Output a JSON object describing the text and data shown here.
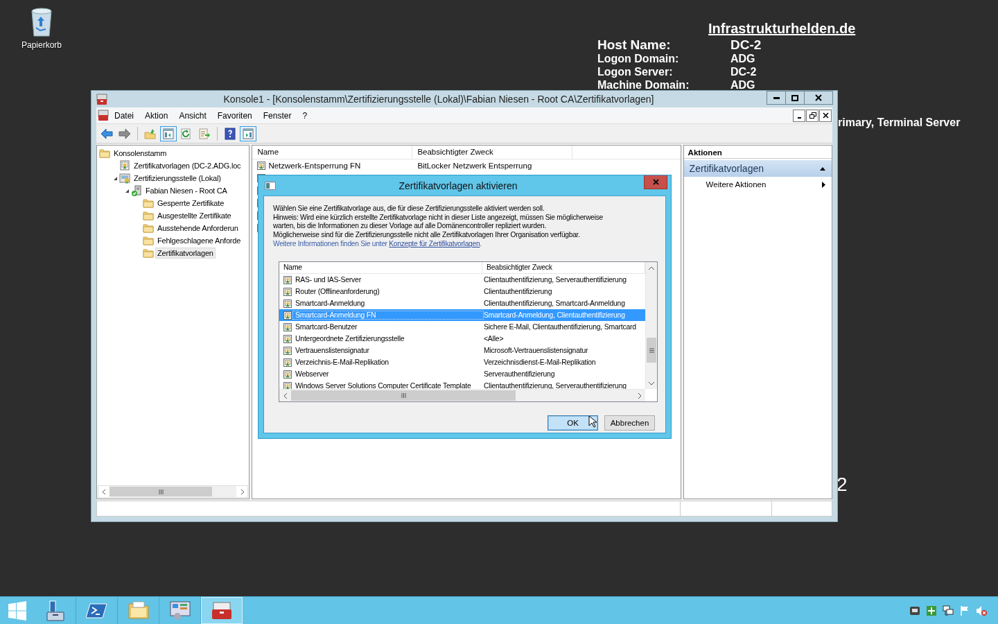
{
  "desktop": {
    "icons": [
      {
        "label": "Papierkorb"
      }
    ],
    "info": {
      "title": "Infrastrukturhelden.de",
      "rows": [
        {
          "label": "Host Name:",
          "value": "DC-2",
          "kind": "large"
        },
        {
          "label": "Logon Domain:",
          "value": "ADG",
          "kind": "normal"
        },
        {
          "label": "Logon Server:",
          "value": "DC-2",
          "kind": "normal"
        },
        {
          "label": "Machine Domain:",
          "value": "ADG",
          "kind": "normal"
        }
      ],
      "fragments": [
        "rimary, Terminal Server",
        "2"
      ]
    }
  },
  "window": {
    "title": "Konsole1 - [Konsolenstamm\\Zertifizierungsstelle (Lokal)\\Fabian Niesen - Root CA\\Zertifikatvorlagen]",
    "menu": [
      "Datei",
      "Aktion",
      "Ansicht",
      "Favoriten",
      "Fenster",
      "?"
    ],
    "toolbar": [
      [
        {
          "kind": "back",
          "on": false
        },
        {
          "kind": "forward",
          "on": false
        }
      ],
      [
        {
          "kind": "up",
          "on": false
        },
        {
          "kind": "console-tree",
          "on": true
        },
        {
          "kind": "refresh",
          "on": false
        },
        {
          "kind": "export",
          "on": false
        }
      ],
      [
        {
          "kind": "help",
          "on": false
        },
        {
          "kind": "action-pane",
          "on": true
        }
      ]
    ],
    "tree": [
      {
        "label": "Konsolenstamm",
        "kind": "folder",
        "selected": false,
        "children": [
          {
            "label": "Zertifikatvorlagen (DC-2.ADG.loc",
            "kind": "template",
            "expanded": false,
            "selected": false
          },
          {
            "label": "Zertifizierungsstelle (Lokal)",
            "kind": "authority",
            "expanded": true,
            "selected": false,
            "children": [
              {
                "label": "Fabian Niesen - Root CA",
                "kind": "server",
                "expanded": true,
                "selected": false,
                "children": [
                  {
                    "label": "Gesperrte Zertifikate",
                    "kind": "folder",
                    "expanded": false,
                    "selected": false
                  },
                  {
                    "label": "Ausgestellte Zertifikate",
                    "kind": "folder",
                    "expanded": false,
                    "selected": false
                  },
                  {
                    "label": "Ausstehende Anforderun",
                    "kind": "folder",
                    "expanded": false,
                    "selected": false
                  },
                  {
                    "label": "Fehlgeschlagene Anforde",
                    "kind": "folder",
                    "expanded": false,
                    "selected": false
                  },
                  {
                    "label": "Zertifikatvorlagen",
                    "kind": "folder",
                    "expanded": false,
                    "selected": true
                  }
                ]
              }
            ]
          }
        ]
      }
    ],
    "list": {
      "columns": [
        "Name",
        "Beabsichtigter Zweck"
      ],
      "rows": [
        {
          "name": "Netzwerk-Entsperrung FN",
          "purpose": "BitLocker Netzwerk Entsperrung"
        }
      ]
    },
    "actions": {
      "title": "Aktionen",
      "section": "Zertifikatvorlagen",
      "expanded": true,
      "items": [
        "Weitere Aktionen"
      ]
    }
  },
  "dialog": {
    "title": "Zertifikatvorlagen aktivieren",
    "lines": [
      "Wählen Sie eine Zertifikatvorlage aus, die für diese Zertifizierungsstelle aktiviert werden soll.",
      "Hinweis: Wird eine kürzlich erstellte Zertifikatvorlage nicht in dieser Liste angezeigt, müssen Sie möglicherweise",
      "warten, bis die Informationen zu dieser Vorlage auf alle Domänencontroller repliziert wurden.",
      "Möglicherweise sind für die Zertifizierungsstelle nicht alle Zertifikatvorlagen Ihrer Organisation verfügbar."
    ],
    "more": {
      "text": "Weitere Informationen finden Sie unter ",
      "link": "Konzepte für Zertifikatvorlagen",
      "end": "."
    },
    "columns": [
      "Name",
      "Beabsichtigter Zweck"
    ],
    "rows": [
      {
        "name": "RAS- und IAS-Server",
        "purpose": "Clientauthentifizierung, Serverauthentifizierung",
        "selected": false
      },
      {
        "name": "Router (Offlineanforderung)",
        "purpose": "Clientauthentifizierung",
        "selected": false
      },
      {
        "name": "Smartcard-Anmeldung",
        "purpose": "Clientauthentifizierung, Smartcard-Anmeldung",
        "selected": false
      },
      {
        "name": "Smartcard-Anmeldung FN",
        "purpose": "Smartcard-Anmeldung, Clientauthentifizierung",
        "selected": true
      },
      {
        "name": "Smartcard-Benutzer",
        "purpose": "Sichere E-Mail, Clientauthentifizierung, Smartcard",
        "selected": false
      },
      {
        "name": "Untergeordnete Zertifizierungsstelle",
        "purpose": "<Alle>",
        "selected": false
      },
      {
        "name": "Vertrauenslistensignatur",
        "purpose": "Microsoft-Vertrauenslistensignatur",
        "selected": false
      },
      {
        "name": "Verzeichnis-E-Mail-Replikation",
        "purpose": "Verzeichnisdienst-E-Mail-Replikation",
        "selected": false
      },
      {
        "name": "Webserver",
        "purpose": "Serverauthentifizierung",
        "selected": false
      },
      {
        "name": "Windows Server Solutions Computer Certificate Template",
        "purpose": "Clientauthentifizierung, Serverauthentifizierung",
        "selected": false
      }
    ],
    "buttons": [
      {
        "label": "OK",
        "default": true
      },
      {
        "label": "Abbrechen",
        "default": false
      }
    ]
  },
  "taskbar": {
    "apps": [
      {
        "selected": false
      },
      {
        "selected": false
      },
      {
        "selected": false
      },
      {
        "selected": false
      },
      {
        "selected": true
      }
    ]
  }
}
